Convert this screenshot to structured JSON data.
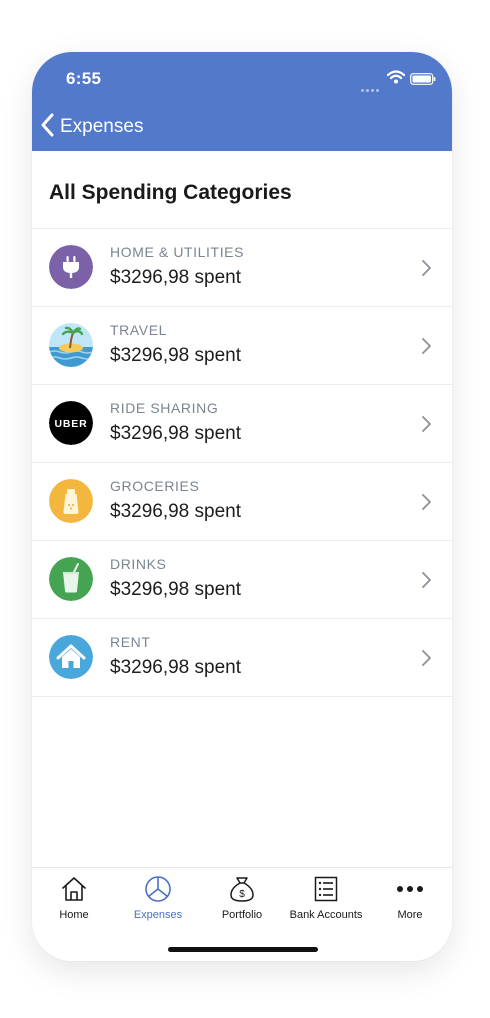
{
  "status_bar": {
    "time": "6:55"
  },
  "nav": {
    "back_label": "Expenses"
  },
  "page": {
    "title": "All Spending Categories"
  },
  "categories": [
    {
      "name": "HOME & UTILITIES",
      "amount": "$3296,98 spent",
      "icon": "plug-icon",
      "color": "#7b62a8"
    },
    {
      "name": "TRAVEL",
      "amount": "$3296,98 spent",
      "icon": "beach-island-icon",
      "color": "#5fb0dd"
    },
    {
      "name": "RIDE SHARING",
      "amount": "$3296,98 spent",
      "icon": "uber-logo",
      "logo_text": "UBER",
      "color": "#000000"
    },
    {
      "name": "GROCERIES",
      "amount": "$3296,98 spent",
      "icon": "salt-shaker-icon",
      "color": "#f3b73e"
    },
    {
      "name": "DRINKS",
      "amount": "$3296,98 spent",
      "icon": "drink-cup-icon",
      "color": "#45a452"
    },
    {
      "name": "RENT",
      "amount": "$3296,98 spent",
      "icon": "house-icon",
      "color": "#4aa7db"
    }
  ],
  "tabs": [
    {
      "label": "Home",
      "icon": "home-icon",
      "active": false
    },
    {
      "label": "Expenses",
      "icon": "pie-chart-icon",
      "active": true
    },
    {
      "label": "Portfolio",
      "icon": "money-bag-icon",
      "active": false
    },
    {
      "label": "Bank Accounts",
      "icon": "list-icon",
      "active": false
    },
    {
      "label": "More",
      "icon": "more-dots-icon",
      "active": false
    }
  ],
  "colors": {
    "header": "#5379cb",
    "tab_active": "#4a6fc4"
  }
}
